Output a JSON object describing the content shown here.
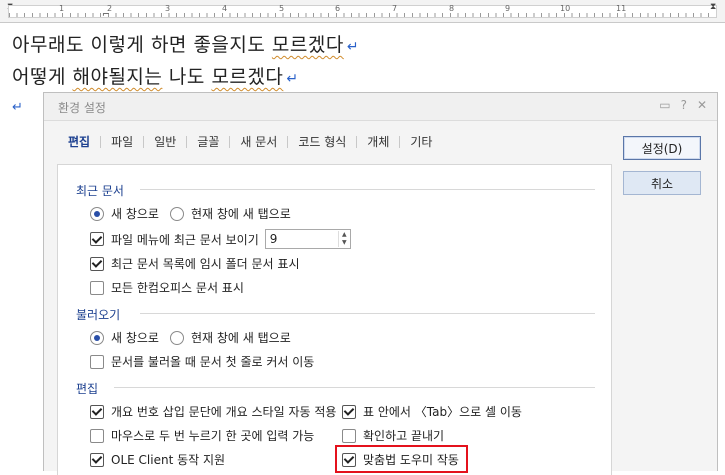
{
  "ruler": {
    "labels": [
      "1",
      "2",
      "3",
      "4",
      "5",
      "6",
      "7",
      "8",
      "9",
      "10",
      "11"
    ]
  },
  "document": {
    "line1": {
      "plain": "아무래도 이렇게 하면 좋을지도 ",
      "underlined": "모르겠다"
    },
    "line2": {
      "p1": "어떻게 ",
      "u1": "해야될지는",
      "p2": " 나도 ",
      "u2": "모르겠다"
    },
    "return_mark": "↵"
  },
  "dialog": {
    "title": "환경 설정",
    "tabs": [
      "편집",
      "파일",
      "일반",
      "글꼴",
      "새 문서",
      "코드 형식",
      "개체",
      "기타"
    ],
    "active_tab": "편집",
    "buttons": {
      "ok": "설정(D)",
      "cancel": "취소"
    },
    "sections": {
      "recent": {
        "title": "최근 문서",
        "radio_new_window": "새 창으로",
        "radio_new_tab": "현재 창에 새 탭으로",
        "show_recent": "파일 메뉴에 최근 문서 보이기",
        "recent_count": "9",
        "show_temp": "최근 문서 목록에 임시 폴더 문서 표시",
        "show_all_office": "모든 한컴오피스 문서 표시"
      },
      "open": {
        "title": "불러오기",
        "radio_new_window": "새 창으로",
        "radio_new_tab": "현재 창에 새 탭으로",
        "cursor_first_line": "문서를 불러올 때 문서 첫 줄로 커서 이동"
      },
      "edit": {
        "title": "편집",
        "outline_style": "개요 번호 삽입 문단에 개요 스타일 자동 적용",
        "table_tab": "표 안에서 〈Tab〉으로 셀 이동",
        "double_click": "마우스로 두 번 누르기 한 곳에 입력 가능",
        "confirm_exit": "확인하고 끝내기",
        "ole_client": "OLE Client 동작 지원",
        "spell_helper": "맞춤법 도우미 작동"
      }
    }
  },
  "colors": {
    "accent": "#1b3f8f",
    "highlight": "#e4111c",
    "return_mark": "#2a61c9"
  }
}
